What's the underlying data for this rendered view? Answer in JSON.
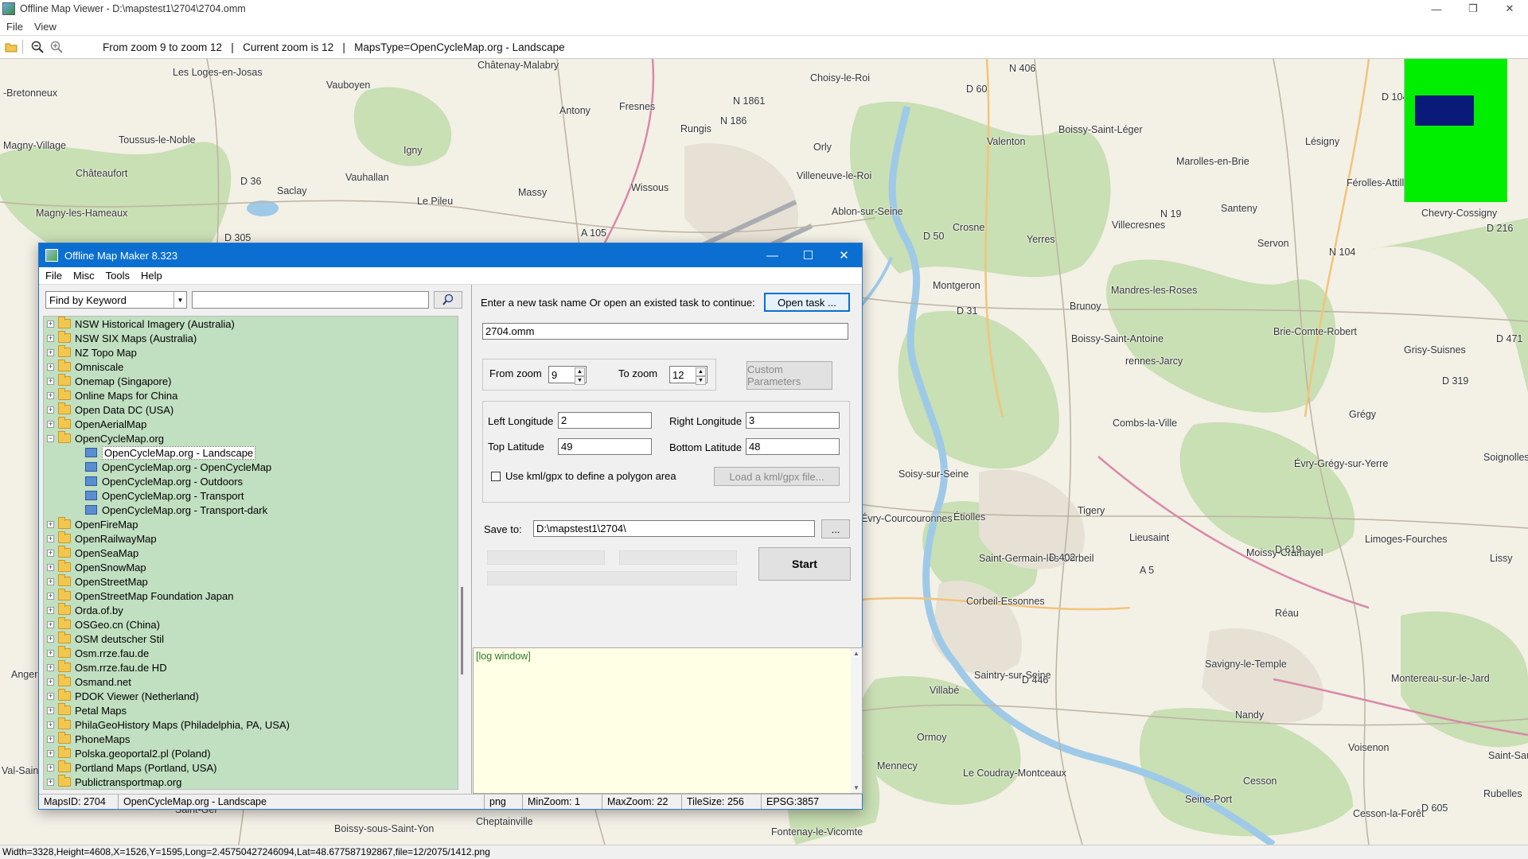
{
  "window": {
    "title": "Offline Map Viewer - D:\\mapstest1\\2704\\2704.omm",
    "controls": [
      "—",
      "❐",
      "✕"
    ]
  },
  "menu": [
    "File",
    "View"
  ],
  "toolbar": {
    "icons": [
      "open-folder-icon",
      "zoom-out-icon",
      "zoom-in-icon"
    ],
    "status": "From zoom 9 to zoom 12   |   Current zoom is 12   |   MapsType=OpenCycleMap.org - Landscape"
  },
  "map": {
    "labels": [
      "Châtenay-Malabry",
      "Les Loges-en-Josas",
      "Vauboyen",
      "Choisy-le-Roi",
      "-Bretonneux",
      "Antony",
      "N 1861",
      "Fresnes",
      "Rungis",
      "N 186",
      "Boissy-Saint-Léger",
      "Magny-Village",
      "Toussus-le-Noble",
      "Igny",
      "Orly",
      "Valenton",
      "Marolles-en-Brie",
      "Lésigny",
      "Châteaufort",
      "Vauhallan",
      "Villeneuve-le-Roi",
      "D 36",
      "Saclay",
      "Wissous",
      "Massy",
      "Férolles-Attilly",
      "Magny-les-Hameaux",
      "Le Pileu",
      "Ablon-sur-Seine",
      "Santeny",
      "Chevry-Cossigny",
      "Crosne",
      "Yerres",
      "Villecresnes",
      "Servon",
      "Montgeron",
      "Mandres-les-Roses",
      "Brunoy",
      "Boissy-Saint-Antoine",
      "Brie-Comte-Robert",
      "Grisy-Suisnes",
      "rennes-Jarcy",
      "Grégy",
      "Combs-la-Ville",
      "Évry-Grégy-sur-Yerre",
      "Soignolles-en",
      "Soisy-sur-Seine",
      "Tigery",
      "Étiolles",
      "Lieusaint",
      "Moissy-Cramayel",
      "Limoges-Fourches",
      "Saint-Germain-lès-Corbeil",
      "Lissy",
      "Corbeil-Essonnes",
      "Réau",
      "Saintry-sur-Seine",
      "Savigny-le-Temple",
      "Montereau-sur-le-Jard",
      "Villabé",
      "Nandy",
      "Ormoy",
      "Voisenon",
      "Mennecy",
      "Le Coudray-Montceaux",
      "Cesson",
      "Saint-Sauveur",
      "Rubelles",
      "Seine-Port",
      "Cesson-la-Forêt",
      "Boissy-sous-Saint-Yon",
      "Cheptainville",
      "Fontenay-le-Vicomte",
      "Saint-Ger",
      "Angers",
      "Val-Saint",
      "Évry-Courcouronnes",
      "D 446",
      "D 31",
      "D 402",
      "A 5",
      "D 305",
      "D 50",
      "D 60",
      "N 406",
      "D 104",
      "N 104",
      "D 216",
      "D 319",
      "D 471",
      "A 105",
      "N 19",
      "D 619",
      "D 605"
    ]
  },
  "bottom_status": "Width=3328,Height=4608,X=1526,Y=1595,Long=2.45750427246094,Lat=48.677587192867,file=12/2075/1412.png",
  "dialog": {
    "title": "Offline Map Maker 8.323",
    "menu": [
      "File",
      "Misc",
      "Tools",
      "Help"
    ],
    "search": {
      "mode": "Find by Keyword",
      "value": ""
    },
    "tree": [
      {
        "label": "NSW Historical Imagery (Australia)",
        "type": "folder"
      },
      {
        "label": "NSW SIX Maps (Australia)",
        "type": "folder"
      },
      {
        "label": "NZ Topo Map",
        "type": "folder"
      },
      {
        "label": "Omniscale",
        "type": "folder"
      },
      {
        "label": "Onemap (Singapore)",
        "type": "folder"
      },
      {
        "label": "Online Maps for China",
        "type": "folder"
      },
      {
        "label": "Open Data DC (USA)",
        "type": "folder"
      },
      {
        "label": "OpenAerialMap",
        "type": "folder"
      },
      {
        "label": "OpenCycleMap.org",
        "type": "folder-open"
      },
      {
        "label": "OpenCycleMap.org - Landscape",
        "type": "leaf",
        "selected": true
      },
      {
        "label": "OpenCycleMap.org - OpenCycleMap",
        "type": "leaf"
      },
      {
        "label": "OpenCycleMap.org - Outdoors",
        "type": "leaf"
      },
      {
        "label": "OpenCycleMap.org - Transport",
        "type": "leaf"
      },
      {
        "label": "OpenCycleMap.org - Transport-dark",
        "type": "leaf"
      },
      {
        "label": "OpenFireMap",
        "type": "folder"
      },
      {
        "label": "OpenRailwayMap",
        "type": "folder"
      },
      {
        "label": "OpenSeaMap",
        "type": "folder"
      },
      {
        "label": "OpenSnowMap",
        "type": "folder"
      },
      {
        "label": "OpenStreetMap",
        "type": "folder"
      },
      {
        "label": "OpenStreetMap Foundation Japan",
        "type": "folder"
      },
      {
        "label": "Orda.of.by",
        "type": "folder"
      },
      {
        "label": "OSGeo.cn (China)",
        "type": "folder"
      },
      {
        "label": "OSM deutscher Stil",
        "type": "folder"
      },
      {
        "label": "Osm.rrze.fau.de",
        "type": "folder"
      },
      {
        "label": "Osm.rrze.fau.de HD",
        "type": "folder"
      },
      {
        "label": "Osmand.net",
        "type": "folder"
      },
      {
        "label": "PDOK Viewer (Netherland)",
        "type": "folder"
      },
      {
        "label": "Petal Maps",
        "type": "folder"
      },
      {
        "label": "PhilaGeoHistory Maps (Philadelphia, PA, USA)",
        "type": "folder"
      },
      {
        "label": "PhoneMaps",
        "type": "folder"
      },
      {
        "label": "Polska.geoportal2.pl (Poland)",
        "type": "folder"
      },
      {
        "label": "Portland Maps (Portland, USA)",
        "type": "folder"
      },
      {
        "label": "Publictransportmap.org",
        "type": "folder"
      }
    ],
    "task": {
      "prompt": "Enter a new task name Or open an existed task to continue:",
      "open_button": "Open task ...",
      "name": "2704.omm"
    },
    "zoom": {
      "from_label": "From zoom",
      "from_value": "9",
      "to_label": "To zoom",
      "to_value": "12",
      "custom_button": "Custom Parameters"
    },
    "bounds": {
      "left_label": "Left Longitude",
      "left_value": "2",
      "right_label": "Right Longitude",
      "right_value": "3",
      "top_label": "Top Latitude",
      "top_value": "49",
      "bottom_label": "Bottom Latitude",
      "bottom_value": "48",
      "kml_label": "Use kml/gpx to define a polygon area",
      "kml_checked": false,
      "kml_button": "Load a kml/gpx file..."
    },
    "save": {
      "label": "Save to:",
      "path": "D:\\mapstest1\\2704\\",
      "browse": "..."
    },
    "start_button": "Start",
    "log": "[log window]",
    "status": [
      "MapsID: 2704",
      "OpenCycleMap.org - Landscape",
      "png",
      "MinZoom: 1",
      "MaxZoom: 22",
      "TileSize: 256",
      "EPSG:3857"
    ]
  },
  "colors": {
    "map_base": "#f3f0e6",
    "forest": "#c9dfb4",
    "water": "#9ecae8",
    "minimap_green": "#00ee00",
    "minimap_view": "#0a1a78",
    "tree_bg": "#c1dfc1",
    "dialog_title": "#0a6fd0",
    "log_bg": "#ffffe5"
  }
}
